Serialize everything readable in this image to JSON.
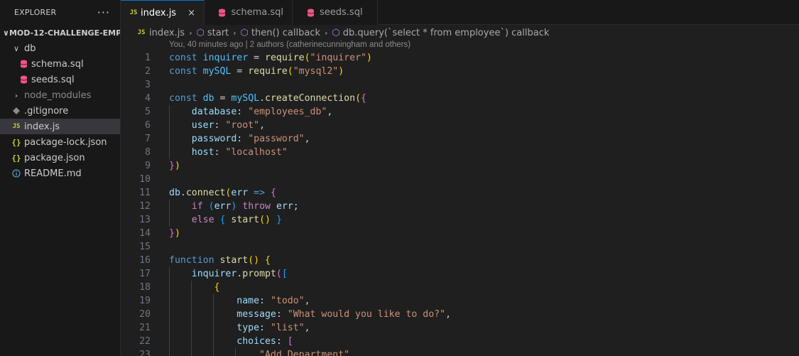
{
  "explorer": {
    "title": "EXPLORER",
    "more": "···",
    "root": "MOD-12-CHALLENGE-EMP...",
    "items": [
      {
        "label": "db",
        "kind": "folder-open"
      },
      {
        "label": "schema.sql",
        "kind": "sql"
      },
      {
        "label": "seeds.sql",
        "kind": "sql"
      },
      {
        "label": "node_modules",
        "kind": "folder-closed"
      },
      {
        "label": ".gitignore",
        "kind": "git"
      },
      {
        "label": "index.js",
        "kind": "js"
      },
      {
        "label": "package-lock.json",
        "kind": "json"
      },
      {
        "label": "package.json",
        "kind": "json"
      },
      {
        "label": "README.md",
        "kind": "info"
      }
    ]
  },
  "tabs": [
    {
      "label": "index.js",
      "active": true
    },
    {
      "label": "schema.sql",
      "active": false
    },
    {
      "label": "seeds.sql",
      "active": false
    }
  ],
  "breadcrumb": [
    "index.js",
    "start",
    "then() callback",
    "db.query(`select * from employee`) callback"
  ],
  "blame": "You, 40 minutes ago | 2 authors (catherinecunningham and others)",
  "icons": {
    "js": "JS",
    "json": "{}",
    "close": "×",
    "chevron_down": "∨",
    "chevron_right": "›"
  },
  "colors": {
    "accent": "#0078d4",
    "sql_icon": "#f55385",
    "js_icon": "#cbcb41",
    "keyword": "#569cd6",
    "string": "#ce9178",
    "function": "#dcdcaa",
    "variable": "#9cdcfe"
  },
  "code_lines": [
    {
      "n": "1",
      "t": "const inquirer = require(\"inquirer\")"
    },
    {
      "n": "2",
      "t": "const mySQL = require(\"mysql2\")"
    },
    {
      "n": "3",
      "t": ""
    },
    {
      "n": "4",
      "t": "const db = mySQL.createConnection({"
    },
    {
      "n": "5",
      "t": "    database: \"employees_db\","
    },
    {
      "n": "6",
      "t": "    user: \"root\","
    },
    {
      "n": "7",
      "t": "    password: \"password\","
    },
    {
      "n": "8",
      "t": "    host: \"localhost\""
    },
    {
      "n": "9",
      "t": "})"
    },
    {
      "n": "10",
      "t": ""
    },
    {
      "n": "11",
      "t": "db.connect(err => {"
    },
    {
      "n": "12",
      "t": "    if (err) throw err;"
    },
    {
      "n": "13",
      "t": "    else { start() }"
    },
    {
      "n": "14",
      "t": "})"
    },
    {
      "n": "15",
      "t": ""
    },
    {
      "n": "16",
      "t": "function start() {"
    },
    {
      "n": "17",
      "t": "    inquirer.prompt(["
    },
    {
      "n": "18",
      "t": "        {"
    },
    {
      "n": "19",
      "t": "            name: \"todo\","
    },
    {
      "n": "20",
      "t": "            message: \"What would you like to do?\","
    },
    {
      "n": "21",
      "t": "            type: \"list\","
    },
    {
      "n": "22",
      "t": "            choices: ["
    },
    {
      "n": "23",
      "t": "                \"Add Department\","
    }
  ]
}
